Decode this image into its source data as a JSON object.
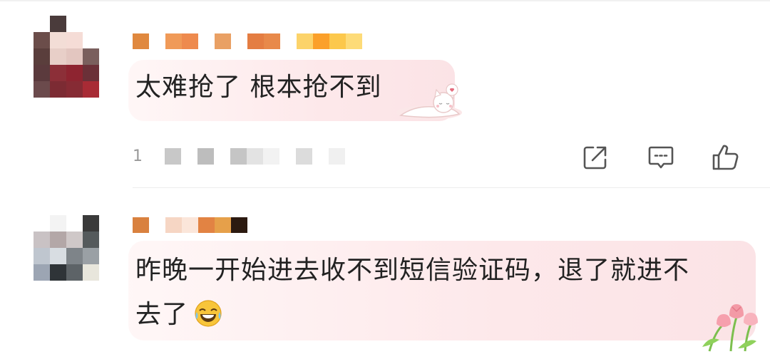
{
  "comments": [
    {
      "text": "太难抢了 根本抢不到",
      "meta_text": "1",
      "actions": [
        "share-icon",
        "comment-icon",
        "like-icon"
      ],
      "sticker": "sleeping-cat-sticker"
    },
    {
      "text_line1": "昨晚一开始进去收不到短信验证码，退了就进不",
      "text_line2": "去了",
      "emoji": "laughing-crying-emoji",
      "sticker": "tulip-flowers-sticker"
    }
  ],
  "colors": {
    "text": "#222222",
    "meta": "#999999",
    "icon": "#555555",
    "bubble": "#fde8ea"
  }
}
